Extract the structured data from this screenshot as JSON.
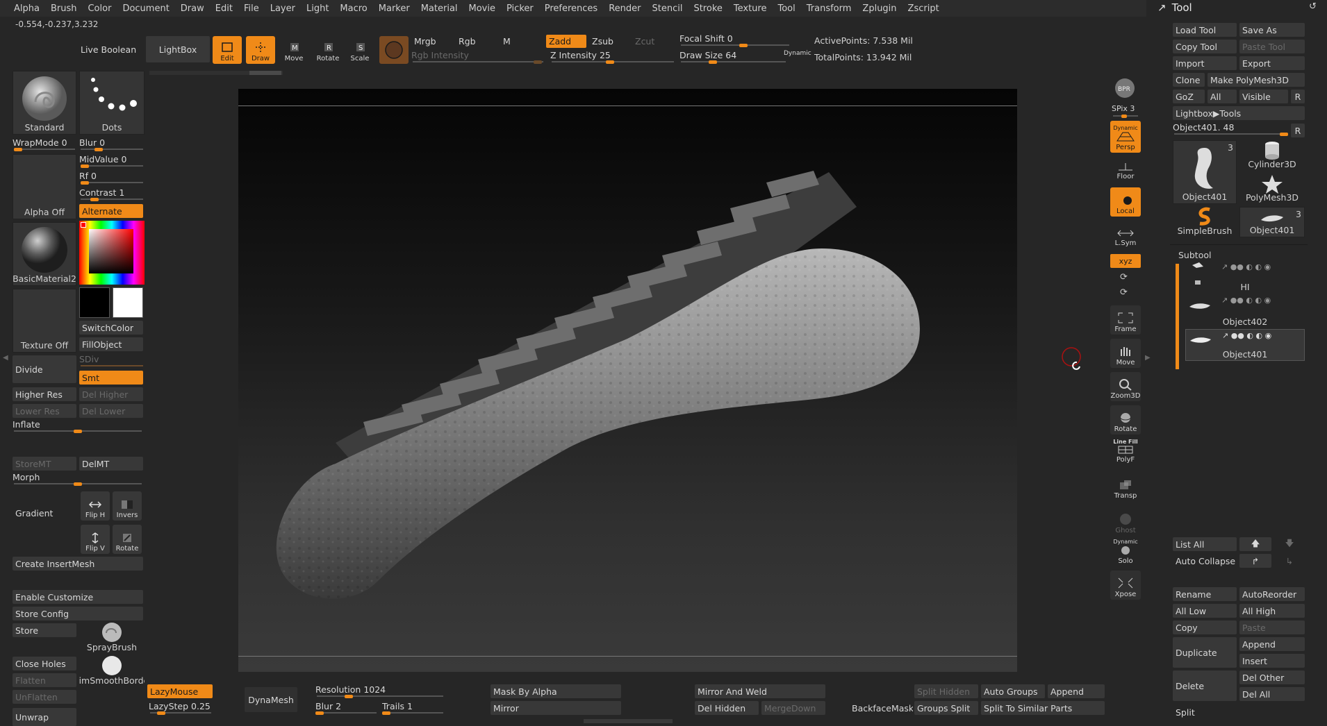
{
  "menu": [
    "Alpha",
    "Brush",
    "Color",
    "Document",
    "Draw",
    "Edit",
    "File",
    "Layer",
    "Light",
    "Macro",
    "Marker",
    "Material",
    "Movie",
    "Picker",
    "Preferences",
    "Render",
    "Stencil",
    "Stroke",
    "Texture",
    "Tool",
    "Transform",
    "Zplugin",
    "Zscript"
  ],
  "coords": "-0.554,-0.237,3.232",
  "top": {
    "live_boolean": "Live Boolean",
    "lightbox": "LightBox",
    "edit": "Edit",
    "draw": "Draw",
    "move": "Move",
    "rotate": "Rotate",
    "scale": "Scale",
    "mrgb": "Mrgb",
    "rgb": "Rgb",
    "m": "M",
    "rgb_intensity": "Rgb Intensity",
    "zadd": "Zadd",
    "zsub": "Zsub",
    "zcut": "Zcut",
    "z_intensity_label": "Z Intensity",
    "z_intensity": "25",
    "focal_shift_label": "Focal Shift",
    "focal_shift": "0",
    "draw_size_label": "Draw Size",
    "draw_size": "64",
    "dynamic": "Dynamic",
    "active_points": "ActivePoints: 7.538 Mil",
    "total_points": "TotalPoints: 13.942 Mil"
  },
  "left": {
    "brush": "Standard",
    "stroke": "Dots",
    "wrapmode": "WrapMode 0",
    "blur": "Blur 0",
    "midvalue": "MidValue 0",
    "rf": "Rf 0",
    "contrast": "Contrast 1",
    "alternate": "Alternate",
    "alpha_off": "Alpha Off",
    "material": "BasicMaterial2",
    "switchcolor": "SwitchColor",
    "fillobject": "FillObject",
    "texture_off": "Texture Off",
    "divide": "Divide",
    "sdiv": "SDiv",
    "smt": "Smt",
    "higher_res": "Higher Res",
    "del_higher": "Del Higher",
    "lower_res": "Lower Res",
    "del_lower": "Del Lower",
    "inflate": "Inflate",
    "storemt": "StoreMT",
    "delmt": "DelMT",
    "morph": "Morph",
    "gradient": "Gradient",
    "flip_h": "Flip H",
    "invers": "Invers",
    "flip_v": "Flip V",
    "rotate": "Rotate",
    "create_insertmesh": "Create InsertMesh",
    "enable_customize": "Enable Customize",
    "store_config": "Store Config",
    "store": "Store",
    "spraybrush": "SprayBrush",
    "close_holes": "Close Holes",
    "flatten": "Flatten",
    "unflatten": "UnFlatten",
    "trimsmooth": "TrimSmoothBorder",
    "unwrap": "Unwrap"
  },
  "shelf": {
    "bpr": "BPR",
    "spix": "SPix 3",
    "dynamic": "Dynamic",
    "persp": "Persp",
    "floor": "Floor",
    "local": "Local",
    "lsym": "L.Sym",
    "xyz": "xyz",
    "frame": "Frame",
    "move": "Move",
    "zoom3d": "Zoom3D",
    "rotate": "Rotate",
    "line_fill": "Line Fill",
    "polyf": "PolyF",
    "transp": "Transp",
    "ghost": "Ghost",
    "solo_dynamic": "Dynamic",
    "solo": "Solo",
    "xpose": "Xpose"
  },
  "bottom": {
    "lazymouse": "LazyMouse",
    "lazystep": "LazyStep 0.25",
    "dynamesh": "DynaMesh",
    "resolution_label": "Resolution",
    "resolution": "1024",
    "blur": "Blur 2",
    "trails": "Trails 1",
    "mask_by_alpha": "Mask By Alpha",
    "mirror": "Mirror",
    "mirror_and_weld": "Mirror And Weld",
    "del_hidden": "Del Hidden",
    "mergedown": "MergeDown",
    "backfacemask": "BackfaceMask",
    "split_hidden": "Split Hidden",
    "groups_split": "Groups Split",
    "auto_groups": "Auto Groups",
    "split_similar": "Split To Similar Parts",
    "append": "Append"
  },
  "tool": {
    "title": "Tool",
    "load_tool": "Load Tool",
    "save_as": "Save As",
    "copy_tool": "Copy Tool",
    "paste_tool": "Paste Tool",
    "import": "Import",
    "export": "Export",
    "clone": "Clone",
    "make_polymesh": "Make PolyMesh3D",
    "goz": "GoZ",
    "all": "All",
    "visible": "Visible",
    "r": "R",
    "lightbox_tools": "Lightbox▶Tools",
    "object_slider": "Object401. 48",
    "thumbs": [
      "Object401",
      "Cylinder3D",
      "PolyMesh3D",
      "SimpleBrush",
      "Object401"
    ],
    "thumb_count_a": "3",
    "thumb_count_b": "3",
    "subtool_title": "Subtool",
    "subtools": [
      "HI",
      "Object402",
      "Object401"
    ],
    "list_all": "List All",
    "auto_collapse": "Auto Collapse",
    "rename": "Rename",
    "autoreorder": "AutoReorder",
    "all_low": "All Low",
    "all_high": "All High",
    "copy": "Copy",
    "paste": "Paste",
    "duplicate": "Duplicate",
    "append": "Append",
    "insert": "Insert",
    "delete": "Delete",
    "del_other": "Del Other",
    "del_all": "Del All",
    "split": "Split"
  },
  "colors": {
    "accent": "#f08a18",
    "bg": "#262626",
    "button": "#383838"
  }
}
